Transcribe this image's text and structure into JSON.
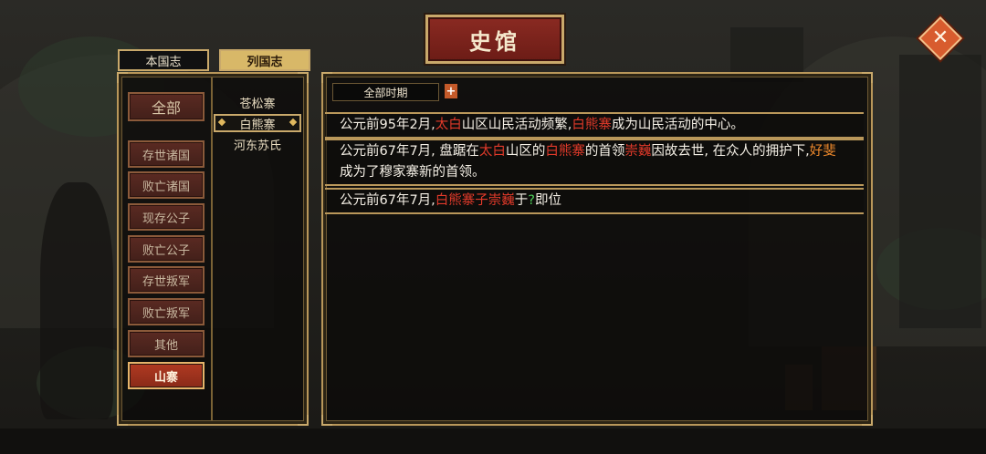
{
  "window": {
    "title": "史馆",
    "close_icon": "close-icon"
  },
  "tabs": [
    {
      "label": "本国志",
      "active": false
    },
    {
      "label": "列国志",
      "active": true
    }
  ],
  "categories": [
    {
      "label": "全部",
      "active": false
    },
    {
      "label": "存世诸国",
      "active": false
    },
    {
      "label": "败亡诸国",
      "active": false
    },
    {
      "label": "现存公子",
      "active": false
    },
    {
      "label": "败亡公子",
      "active": false
    },
    {
      "label": "存世叛军",
      "active": false
    },
    {
      "label": "败亡叛军",
      "active": false
    },
    {
      "label": "其他",
      "active": false
    },
    {
      "label": "山寨",
      "active": true
    }
  ],
  "subitems": [
    {
      "label": "苍松寨",
      "selected": false
    },
    {
      "label": "白熊寨",
      "selected": true
    },
    {
      "label": "河东苏氏",
      "selected": false
    }
  ],
  "period": {
    "label": "全部时期",
    "plus": "+"
  },
  "colors": {
    "red_name": "#e23a2a",
    "orange_name": "#f08a2c",
    "green_mark": "#4fcf5a",
    "accent_gold": "#c9a96b"
  },
  "entries": [
    {
      "segments": [
        {
          "t": "公元前95年2月,",
          "c": ""
        },
        {
          "t": "太白",
          "c": "r"
        },
        {
          "t": "山区山民活动频繁,",
          "c": ""
        },
        {
          "t": "白熊寨",
          "c": "r"
        },
        {
          "t": "成为山民活动的中心。",
          "c": ""
        }
      ]
    },
    {
      "segments": [
        {
          "t": "公元前67年7月, 盘踞在",
          "c": ""
        },
        {
          "t": "太白",
          "c": "r"
        },
        {
          "t": "山区的",
          "c": ""
        },
        {
          "t": "白熊寨",
          "c": "r"
        },
        {
          "t": "的首领",
          "c": ""
        },
        {
          "t": "崇巍",
          "c": "r"
        },
        {
          "t": "因故去世, 在众人的拥护下,",
          "c": ""
        },
        {
          "t": "好斐",
          "c": "o"
        },
        {
          "t": "成为了穆家寨新的首领。",
          "c": ""
        }
      ]
    },
    {
      "segments": [
        {
          "t": "公元前67年7月,",
          "c": ""
        },
        {
          "t": "白熊寨子崇巍",
          "c": "r"
        },
        {
          "t": "于",
          "c": ""
        },
        {
          "t": "?",
          "c": "g"
        },
        {
          "t": "即位",
          "c": ""
        }
      ]
    }
  ]
}
